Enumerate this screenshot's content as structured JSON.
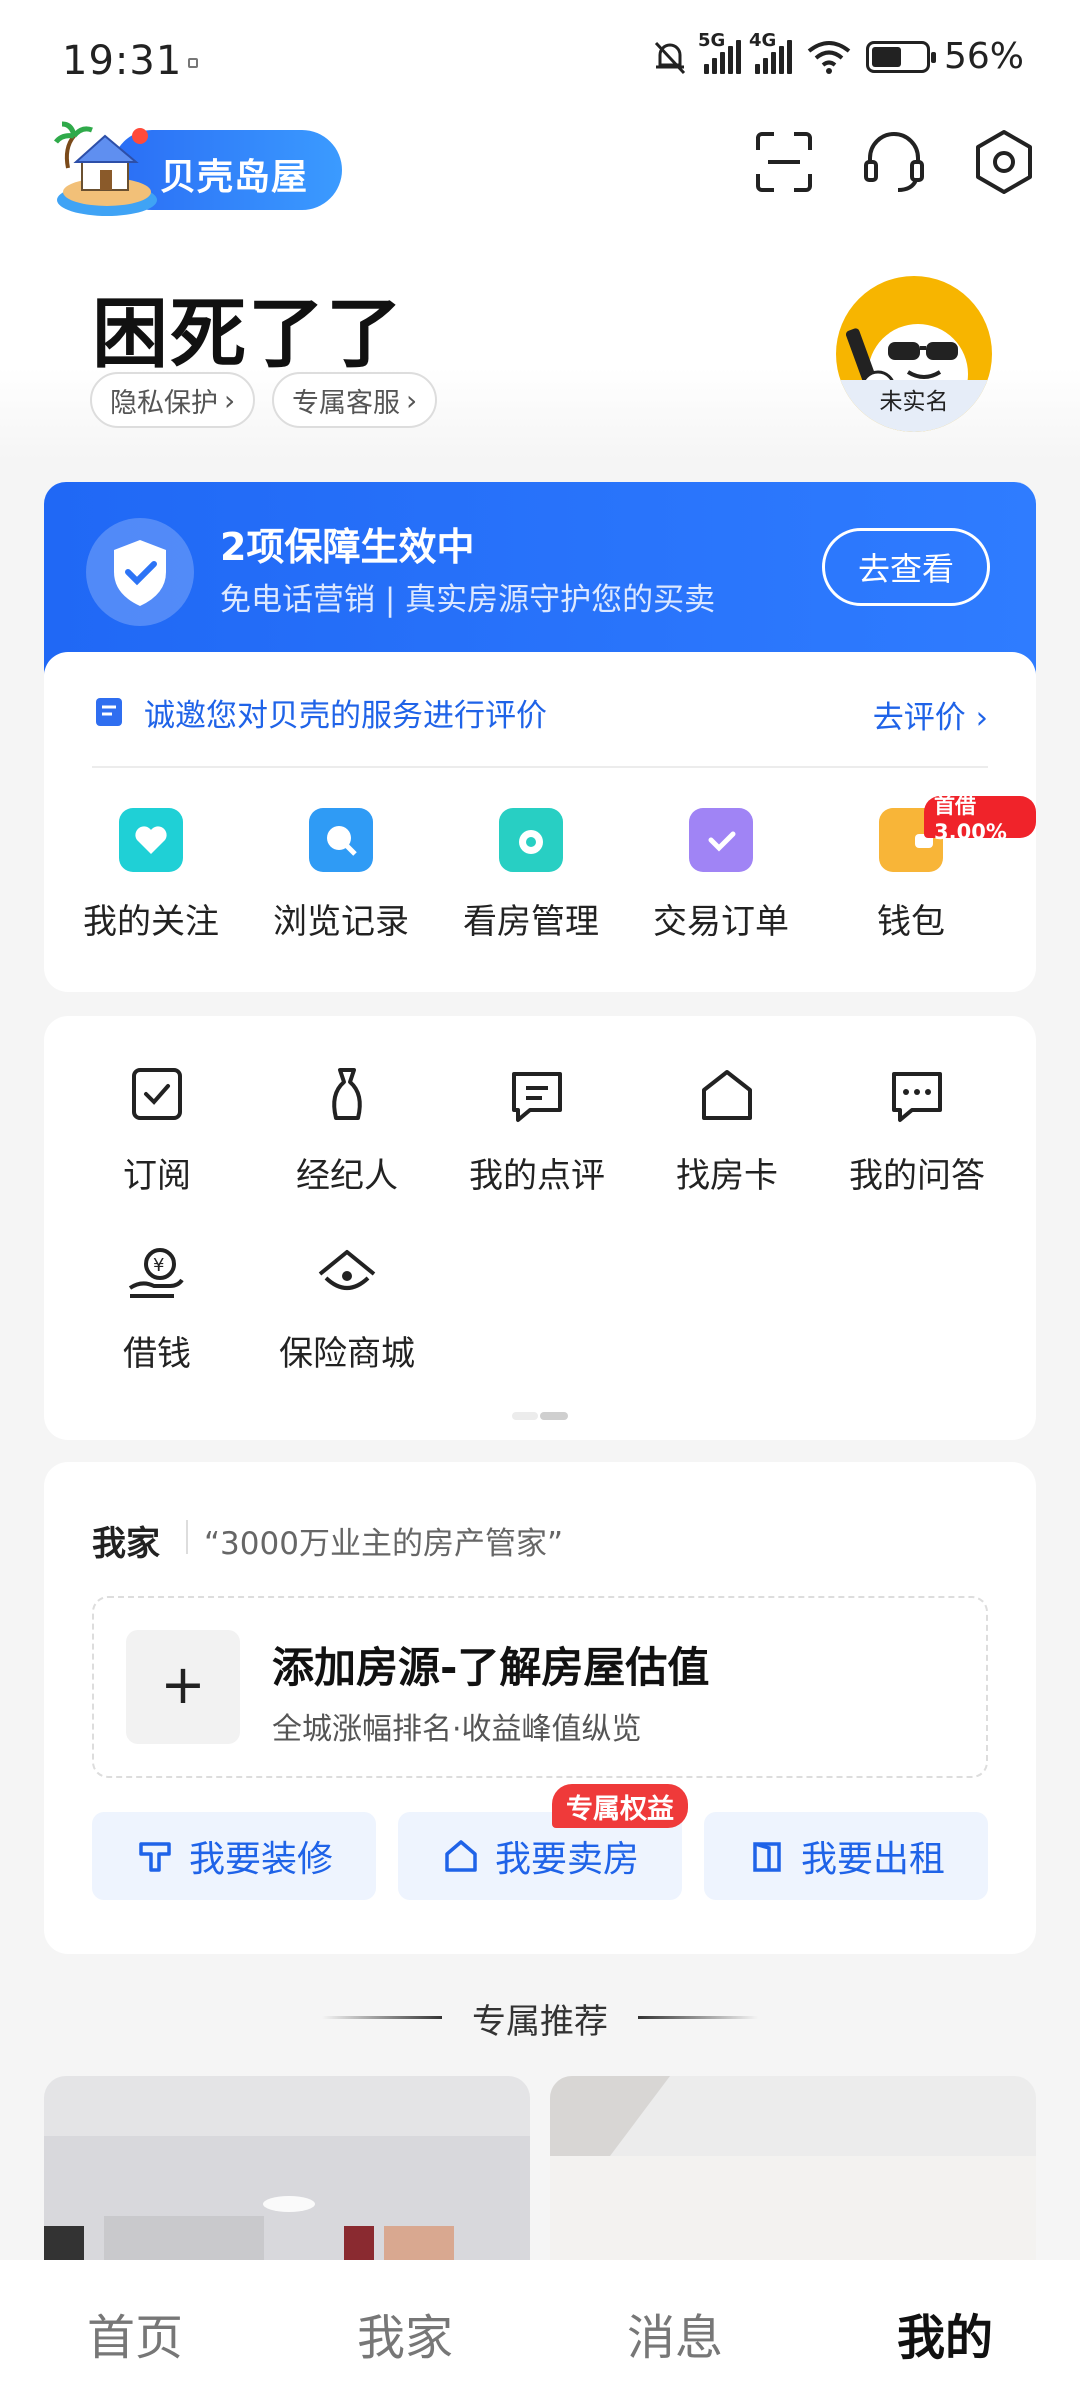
{
  "status_bar": {
    "time": "19:31",
    "net1": "5G",
    "net2": "4G",
    "battery_text": "56%",
    "battery_level": 0.56
  },
  "header": {
    "logo_text": "贝壳岛屋",
    "scan_icon": "scan-icon",
    "service_icon": "headset-icon",
    "settings_icon": "settings-icon"
  },
  "profile": {
    "name": "困死了了",
    "chips": [
      {
        "label": "隐私保护"
      },
      {
        "label": "专属客服"
      }
    ],
    "avatar_tag": "未实名"
  },
  "protection_banner": {
    "title": "2项保障生效中",
    "subtitle": "免电话营销 | 真实房源守护您的买卖",
    "button": "去查看"
  },
  "rating": {
    "text": "诚邀您对贝壳的服务进行评价",
    "link": "去评价"
  },
  "main_grid": [
    {
      "label": "我的关注",
      "icon": "heart-icon",
      "color": "#1fd0d6"
    },
    {
      "label": "浏览记录",
      "icon": "search-icon",
      "color": "#2f9bf5"
    },
    {
      "label": "看房管理",
      "icon": "eye-icon",
      "color": "#28cfc3"
    },
    {
      "label": "交易订单",
      "icon": "clipboard-check-icon",
      "color": "#a084f5"
    },
    {
      "label": "钱包",
      "icon": "wallet-icon",
      "color": "#f8b538"
    }
  ],
  "wallet_badge": "首借3.00%",
  "tools": [
    {
      "label": "订阅",
      "icon": "subscribe-icon"
    },
    {
      "label": "经纪人",
      "icon": "agent-icon"
    },
    {
      "label": "我的点评",
      "icon": "comment-icon"
    },
    {
      "label": "找房卡",
      "icon": "house-card-icon"
    },
    {
      "label": "我的问答",
      "icon": "qa-icon"
    },
    {
      "label": "借钱",
      "icon": "loan-icon"
    },
    {
      "label": "保险商城",
      "icon": "insurance-icon"
    }
  ],
  "my_home": {
    "title": "我家",
    "slogan": "“3000万业主的房产管家”",
    "add_title": "添加房源-了解房屋估值",
    "add_subtitle": "全城涨幅排名·收益峰值纵览",
    "actions": [
      {
        "label": "我要装修"
      },
      {
        "label": "我要卖房"
      },
      {
        "label": "我要出租"
      }
    ],
    "sell_tag": "专属权益"
  },
  "recommend": {
    "title": "专属推荐"
  },
  "bottom_nav": [
    {
      "label": "首页"
    },
    {
      "label": "我家"
    },
    {
      "label": "消息"
    },
    {
      "label": "我的"
    }
  ]
}
